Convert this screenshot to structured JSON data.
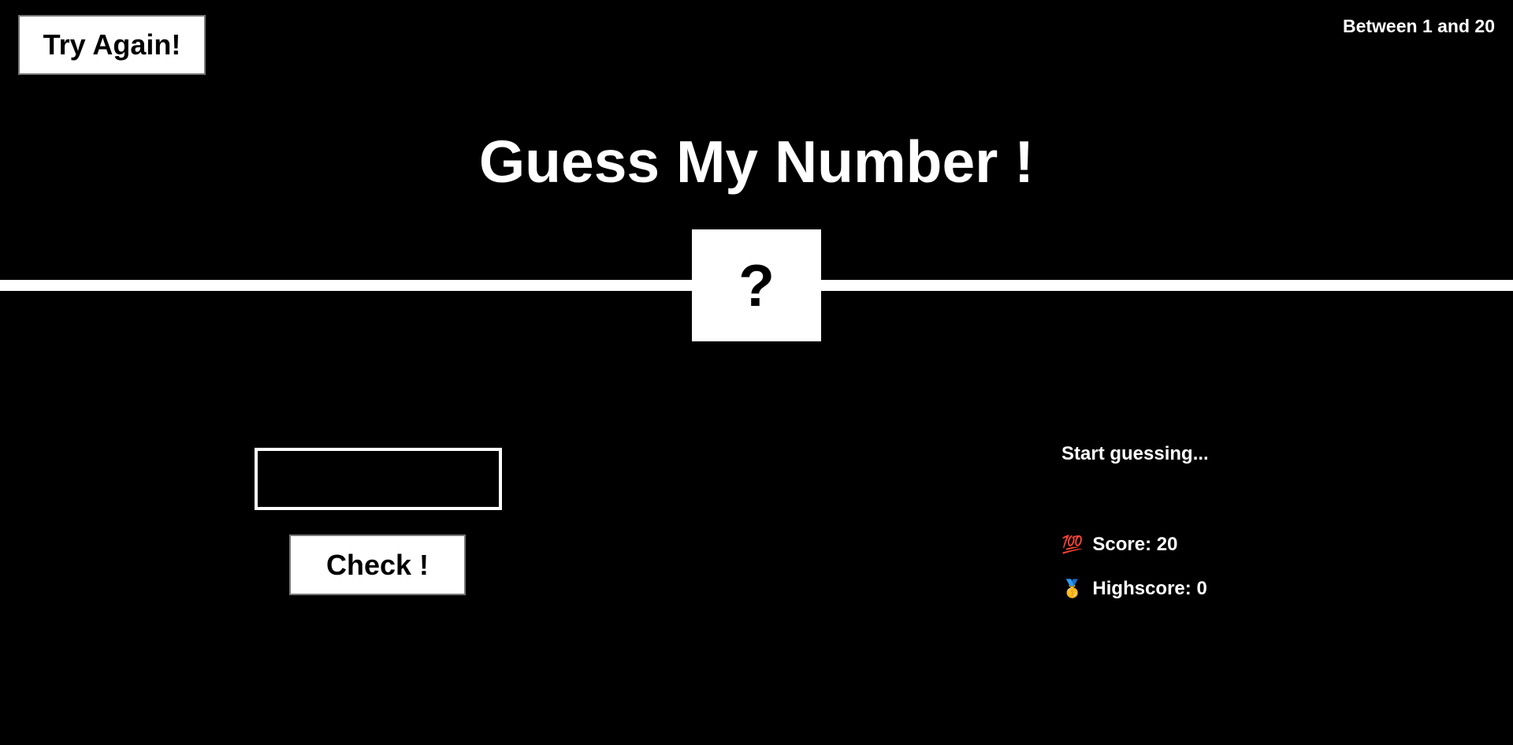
{
  "header": {
    "again_label": "Try Again!",
    "range_label": "Between 1 and 20"
  },
  "main": {
    "title": "Guess My Number !",
    "secret_display": "?"
  },
  "left": {
    "guess_value": "",
    "check_label": "Check !"
  },
  "right": {
    "message": "Start guessing...",
    "score_icon": "💯",
    "score_label": "Score: ",
    "score_value": "20",
    "highscore_icon": "🥇",
    "highscore_label": "Highscore: ",
    "highscore_value": "0"
  },
  "colors": {
    "background": "#000000",
    "foreground": "#ffffff"
  }
}
